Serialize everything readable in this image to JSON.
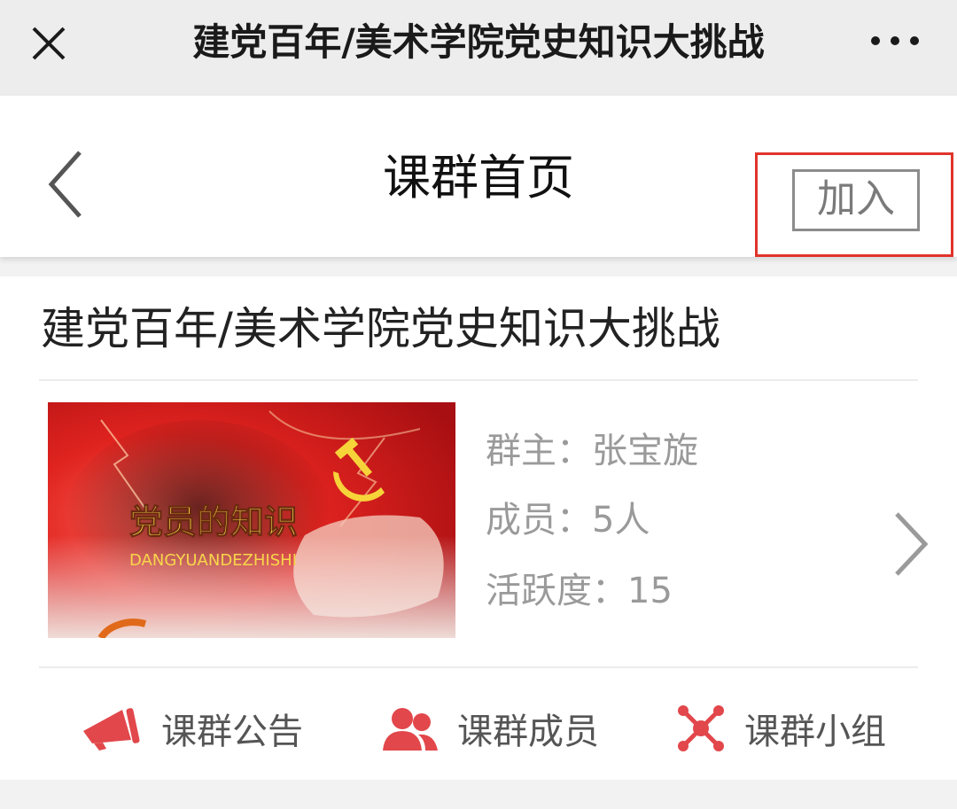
{
  "window": {
    "title": "建党百年/美术学院党史知识大挑战",
    "close_icon": "close-icon",
    "more_icon": "more-dots-icon"
  },
  "navbar": {
    "title": "课群首页",
    "back_icon": "chevron-left-icon",
    "join_label": "加入",
    "highlight_color": "#e0342b"
  },
  "group": {
    "name": "建党百年/美术学院党史知识大挑战",
    "cover": {
      "title": "党员的知识",
      "subtitle": "DANGYUANDEZHISHI"
    },
    "owner": "群主：张宝旋",
    "members": "成员：5人",
    "activity": "活跃度：15"
  },
  "actions": [
    {
      "label": "课群公告",
      "icon": "megaphone-icon"
    },
    {
      "label": "课群成员",
      "icon": "members-icon"
    },
    {
      "label": "课群小组",
      "icon": "network-icon"
    }
  ],
  "colors": {
    "accent": "#e2474b",
    "cover_red": "#d9201e"
  }
}
